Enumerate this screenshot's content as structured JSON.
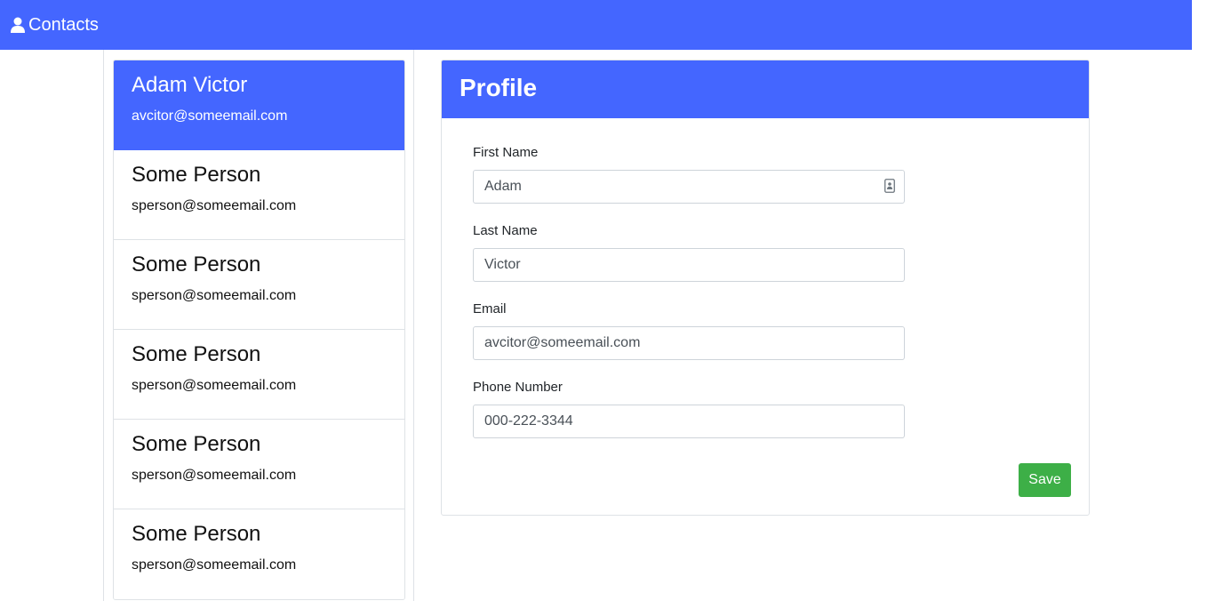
{
  "navbar": {
    "brand_label": "Contacts",
    "brand_icon": "user-icon"
  },
  "contacts": [
    {
      "name": "Adam Victor",
      "email": "avcitor@someemail.com",
      "active": true
    },
    {
      "name": "Some Person",
      "email": "sperson@someemail.com",
      "active": false
    },
    {
      "name": "Some Person",
      "email": "sperson@someemail.com",
      "active": false
    },
    {
      "name": "Some Person",
      "email": "sperson@someemail.com",
      "active": false
    },
    {
      "name": "Some Person",
      "email": "sperson@someemail.com",
      "active": false
    },
    {
      "name": "Some Person",
      "email": "sperson@someemail.com",
      "active": false
    }
  ],
  "profile": {
    "title": "Profile",
    "fields": {
      "first_name": {
        "label": "First Name",
        "value": "Adam"
      },
      "last_name": {
        "label": "Last Name",
        "value": "Victor"
      },
      "email": {
        "label": "Email",
        "value": "avcitor@someemail.com"
      },
      "phone": {
        "label": "Phone Number",
        "value": "000-222-3344"
      }
    },
    "save_label": "Save"
  },
  "colors": {
    "primary": "#4466ff",
    "success": "#3daf47",
    "border": "#dee2e6"
  }
}
